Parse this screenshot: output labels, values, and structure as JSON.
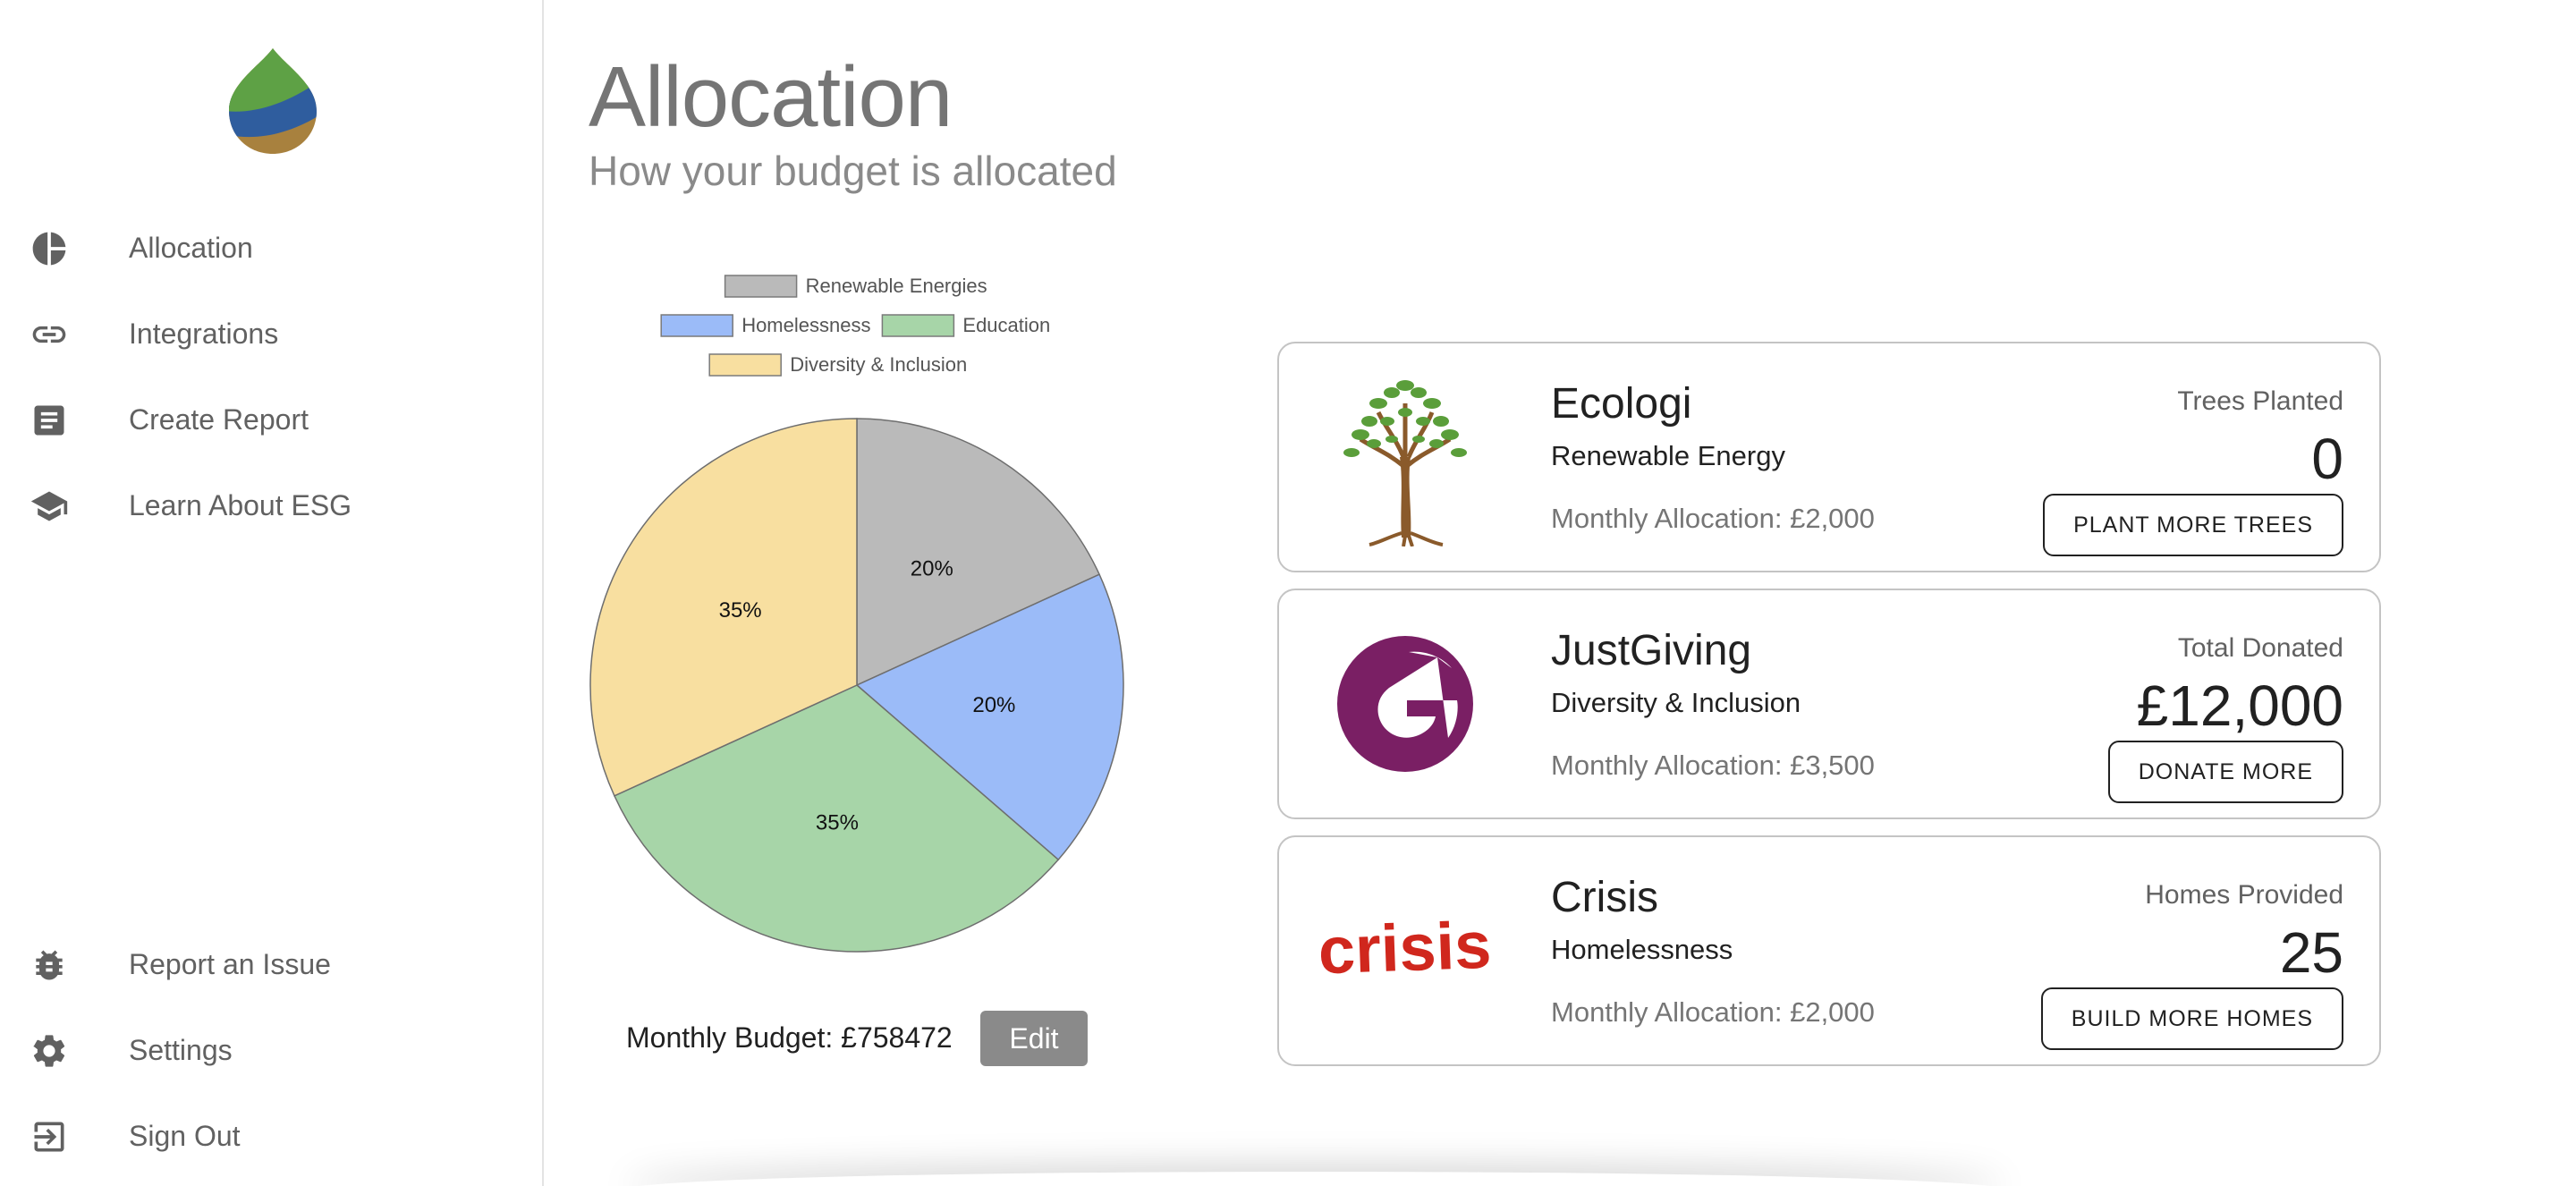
{
  "sidebar": {
    "items": [
      {
        "label": "Allocation",
        "icon": "pie-chart-icon"
      },
      {
        "label": "Integrations",
        "icon": "link-icon"
      },
      {
        "label": "Create Report",
        "icon": "document-icon"
      },
      {
        "label": "Learn About ESG",
        "icon": "school-icon"
      }
    ],
    "bottom_items": [
      {
        "label": "Report an Issue",
        "icon": "bug-icon"
      },
      {
        "label": "Settings",
        "icon": "gear-icon"
      },
      {
        "label": "Sign Out",
        "icon": "sign-out-icon"
      }
    ]
  },
  "page": {
    "title": "Allocation",
    "subtitle": "How your budget is allocated"
  },
  "chart_data": {
    "type": "pie",
    "legend_position": "top",
    "series": [
      {
        "name": "Renewable Energies",
        "value": 20,
        "label": "20%",
        "color": "#bababa"
      },
      {
        "name": "Homelessness",
        "value": 20,
        "label": "20%",
        "color": "#9bbbf8"
      },
      {
        "name": "Education",
        "value": 35,
        "label": "35%",
        "color": "#a7d5a8"
      },
      {
        "name": "Diversity & Inclusion",
        "value": 35,
        "label": "35%",
        "color": "#f8dfa0"
      }
    ]
  },
  "budget": {
    "label": "Monthly Budget: £758472",
    "edit_label": "Edit"
  },
  "cards": [
    {
      "name": "Ecologi",
      "category": "Renewable Energy",
      "allocation": "Monthly Allocation: £2,000",
      "metric_label": "Trees Planted",
      "metric_value": "0",
      "action_label": "PLANT MORE TREES",
      "logo": "tree-logo"
    },
    {
      "name": "JustGiving",
      "category": "Diversity & Inclusion",
      "allocation": "Monthly Allocation: £3,500",
      "metric_label": "Total Donated",
      "metric_value": "£12,000",
      "action_label": "DONATE MORE",
      "logo": "justgiving-logo"
    },
    {
      "name": "Crisis",
      "category": "Homelessness",
      "allocation": "Monthly Allocation: £2,000",
      "metric_label": "Homes Provided",
      "metric_value": "25",
      "action_label": "BUILD MORE HOMES",
      "logo": "crisis-logo"
    }
  ],
  "colors": {
    "justgiving": "#7a1f64",
    "crisis": "#d0271d",
    "edit_button": "#8a8a8a"
  }
}
